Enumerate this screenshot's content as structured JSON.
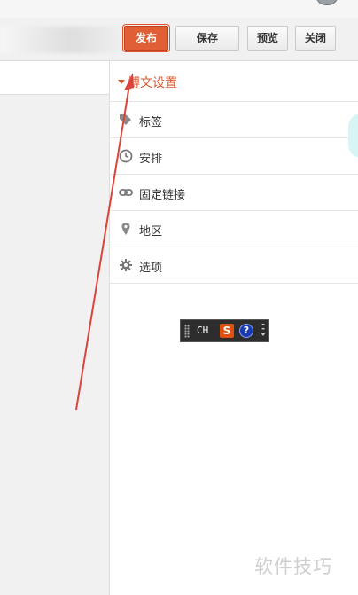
{
  "toolbar": {
    "publish_label": "发布",
    "save_label": "保存",
    "preview_label": "预览",
    "close_label": "关闭"
  },
  "settings_panel": {
    "title": "博文设置",
    "items": [
      {
        "label": "标签",
        "icon": "tag-icon"
      },
      {
        "label": "安排",
        "icon": "clock-icon"
      },
      {
        "label": "固定链接",
        "icon": "link-icon"
      },
      {
        "label": "地区",
        "icon": "location-pin-icon"
      },
      {
        "label": "选项",
        "icon": "gear-icon"
      }
    ]
  },
  "ime_toolbar": {
    "mode": "CH",
    "logo": "S",
    "help": "?"
  },
  "watermark": "软件技巧",
  "colors": {
    "accent": "#e05f34",
    "panel_title": "#d55b31",
    "annotation_arrow": "#d9453c"
  }
}
